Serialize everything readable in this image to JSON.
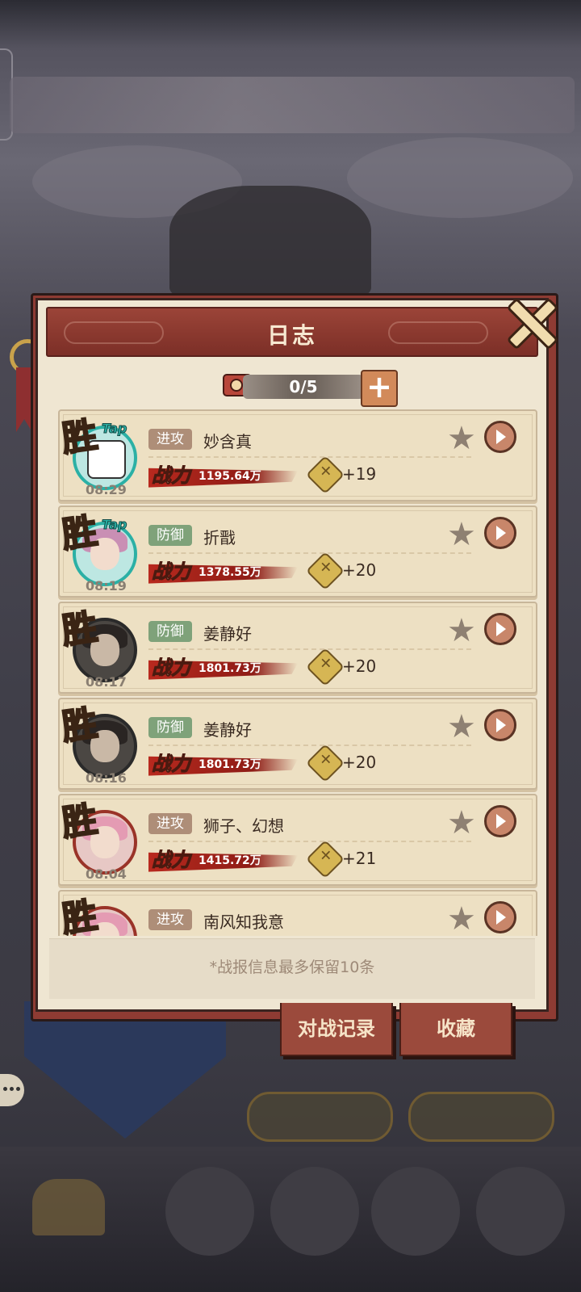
{
  "dialog": {
    "title": "日志",
    "counter": "0/5",
    "plus_label": "+",
    "footer_note": "*战报信息最多保留10条"
  },
  "entries": [
    {
      "result": "胜",
      "tap": "Tap",
      "time": "08:29",
      "type": "进攻",
      "name": "妙含真",
      "power_label": "战力",
      "power": "1195.64万",
      "gain": "+19",
      "avatar_style": "teal"
    },
    {
      "result": "胜",
      "tap": "Tap",
      "time": "08:19",
      "type": "防御",
      "name": "折戬",
      "power_label": "战力",
      "power": "1378.55万",
      "gain": "+20",
      "avatar_style": "teal"
    },
    {
      "result": "胜",
      "tap": "",
      "time": "08:17",
      "type": "防御",
      "name": "姜静好",
      "power_label": "战力",
      "power": "1801.73万",
      "gain": "+20",
      "avatar_style": "dark"
    },
    {
      "result": "胜",
      "tap": "",
      "time": "08:16",
      "type": "防御",
      "name": "姜静好",
      "power_label": "战力",
      "power": "1801.73万",
      "gain": "+20",
      "avatar_style": "dark"
    },
    {
      "result": "胜",
      "tap": "",
      "time": "08:04",
      "type": "进攻",
      "name": "狮子、幻想",
      "power_label": "战力",
      "power": "1415.72万",
      "gain": "+21",
      "avatar_style": "red"
    },
    {
      "result": "胜",
      "tap": "",
      "time": "",
      "type": "进攻",
      "name": "南风知我意",
      "power_label": "战力",
      "power": "",
      "gain": "",
      "avatar_style": "red"
    }
  ],
  "tabs": {
    "battle_record": "对战记录",
    "favorites": "收藏"
  },
  "icons": {
    "star": "★",
    "close": "close-x"
  },
  "colors": {
    "header": "#8e3b33",
    "attack_tag": "#ae8e78",
    "defend_tag": "#7fa27a",
    "power_banner": "#b8291e"
  }
}
